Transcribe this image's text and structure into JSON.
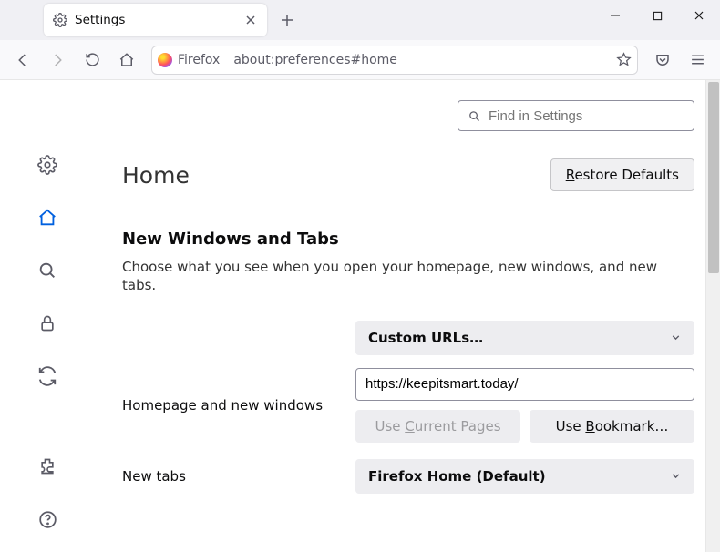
{
  "tab": {
    "title": "Settings"
  },
  "urlbar": {
    "identity": "Firefox",
    "url": "about:preferences#home"
  },
  "search": {
    "placeholder": "Find in Settings"
  },
  "page": {
    "title": "Home",
    "restore": "Restore Defaults"
  },
  "section": {
    "title": "New Windows and Tabs",
    "desc": "Choose what you see when you open your homepage, new windows, and new tabs."
  },
  "homepage": {
    "label": "Homepage and new windows",
    "select": "Custom URLs…",
    "url": "https://keepitsmart.today/",
    "use_current": "Use Current Pages",
    "use_bookmark": "Use Bookmark…"
  },
  "newtabs": {
    "label": "New tabs",
    "select": "Firefox Home (Default)"
  }
}
